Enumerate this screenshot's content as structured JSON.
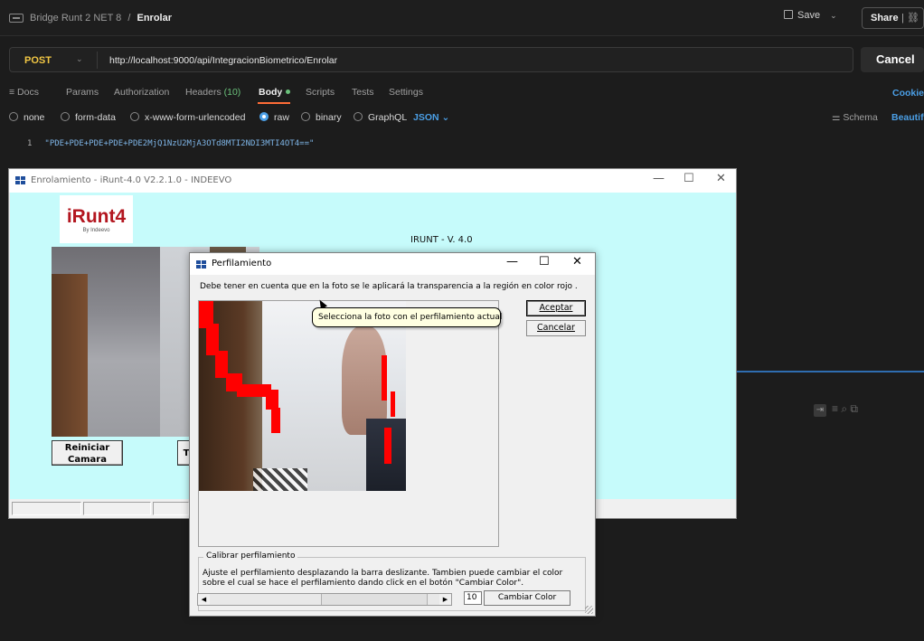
{
  "postman": {
    "breadcrumb_parent": "Bridge Runt 2 NET 8",
    "breadcrumb_sep": "/",
    "breadcrumb_current": "Enrolar",
    "save_label": "Save",
    "share_label": "Share",
    "method": "POST",
    "url": "http://localhost:9000/api/IntegracionBiometrico/Enrolar",
    "cancel_label": "Cancel",
    "tabs": {
      "docs": "Docs",
      "params": "Params",
      "authorization": "Authorization",
      "headers": "Headers",
      "headers_count": "(10)",
      "body": "Body",
      "scripts": "Scripts",
      "tests": "Tests",
      "settings": "Settings"
    },
    "cookies_label": "Cookies",
    "body_types": {
      "none": "none",
      "form_data": "form-data",
      "urlencoded": "x-www-form-urlencoded",
      "raw": "raw",
      "binary": "binary",
      "graphql": "GraphQL",
      "json": "JSON"
    },
    "schema_label": "Schema",
    "beautify_label": "Beautify",
    "code": {
      "line_no": "1",
      "text": "\"PDE+PDE+PDE+PDE+PDE2MjQ1NzU2MjA3OTd8MTI2NDI3MTI4OT4==\""
    }
  },
  "enrol_window": {
    "title": "Enrolamiento - iRunt-4.0 V2.2.1.0 - INDEEVO",
    "logo_text": "iRunt4",
    "logo_by": "By Indeevo",
    "version_label": "IRUNT - V. 4.0",
    "reiniciar_label": "Reiniciar Camara",
    "partial_button_label": "T"
  },
  "dialog": {
    "title": "Perfilamiento",
    "note": "Debe tener en cuenta que en la foto se le aplicará la transparencia a la región en color rojo .",
    "aceptar_label": "Aceptar",
    "cancelar_label": "Cancelar",
    "tooltip": "Selecciona la foto con el perfilamiento actual",
    "calib_legend": "Calibrar perfilamiento",
    "calib_text": "Ajuste el perfilamiento desplazando la barra deslizante. Tambien puede cambiar el color sobre el cual se hace el perfilamiento dando click en el botón \"Cambiar Color\".",
    "slider_value": "10",
    "cambiar_color_label": "Cambiar Color"
  },
  "colors": {
    "postman_bg": "#1c1c1c",
    "method_post": "#f2c744",
    "accent_blue": "#4b9fe6",
    "tab_underline": "#ff6c37",
    "enrol_client_bg": "#c6fbfb",
    "logo_red": "#b3161f",
    "tooltip_bg": "#ffffe1",
    "profile_red": "#ff0000"
  },
  "icons": [
    "workspace-icon",
    "save-disk-icon",
    "chevron-down-icon",
    "link-icon",
    "docs-icon",
    "radio-icon",
    "schema-icon",
    "wrap-icon",
    "filter-icon",
    "search-icon",
    "copy-icon",
    "window-logo-icon",
    "minimize-icon",
    "maximize-icon",
    "close-icon",
    "resize-grip-icon"
  ]
}
